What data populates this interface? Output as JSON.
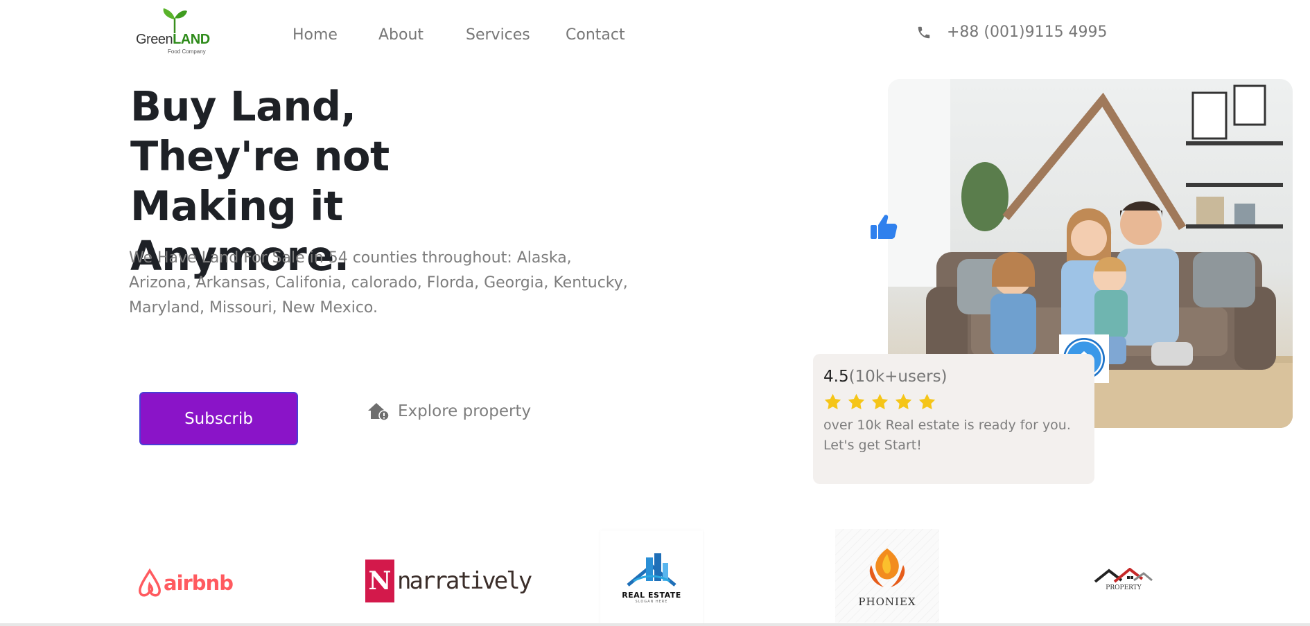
{
  "brand": {
    "name_part1": "Green",
    "name_part2": "LAND",
    "tagline": "Food Company"
  },
  "nav": {
    "items": [
      "Home",
      "About",
      "Services",
      "Contact"
    ]
  },
  "phone": {
    "number": "+88 (001)9115 4995",
    "icon": "phone-icon"
  },
  "hero": {
    "title": "Buy Land, They're not Making it Anymore.",
    "description": "We Have Land For Sale in 54 counties throughout: Alaska, Arizona, Arkansas, Califonia, calorado, Florda, Georgia, Kentucky, Maryland, Missouri, New Mexico.",
    "subscribe_label": "Subscrib",
    "explore_label": "Explore property"
  },
  "rating": {
    "score": "4.5",
    "users": "(10k+users)",
    "stars": 5,
    "message": "over 10k Real estate is ready for you. Let's get Start!"
  },
  "partners": {
    "airbnb": "airbnb",
    "narratively_mark": "N",
    "narratively": "narratively",
    "realestate_title": "REAL ESTATE",
    "realestate_slogan": "SLOGAN HERE",
    "phoenix": "PHONIEX",
    "property": "PROPERTY"
  },
  "colors": {
    "accent": "#8a14c8",
    "star": "#f5c518",
    "like": "#2f80ed",
    "airbnb": "#ff5a5f",
    "narratively": "#d3194b"
  }
}
